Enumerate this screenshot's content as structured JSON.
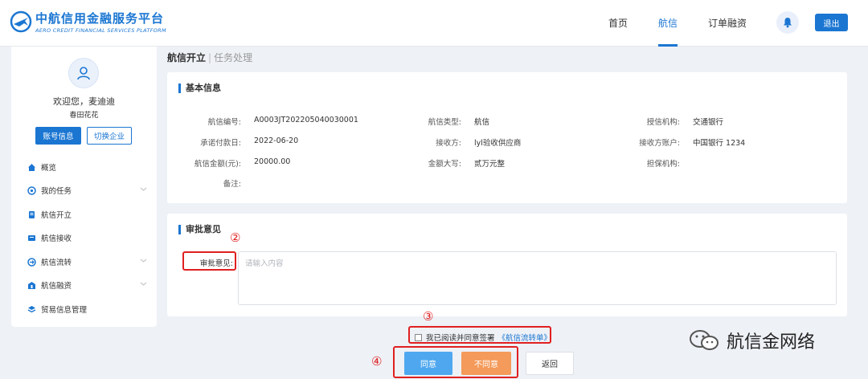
{
  "header": {
    "logo_cn": "中航信用金融服务平台",
    "logo_en": "AERO CREDIT FINANCIAL SERVICES PLATFORM",
    "nav": [
      {
        "label": "首页"
      },
      {
        "label": "航信"
      },
      {
        "label": "订单融资"
      }
    ],
    "active_nav": "航信",
    "logout_label": "退出"
  },
  "sidebar": {
    "welcome": "欢迎您，麦迪迪",
    "company": "春田花花",
    "account_btn": "账号信息",
    "switch_btn": "切换企业",
    "menu": [
      {
        "label": "概览",
        "icon": "home-icon"
      },
      {
        "label": "我的任务",
        "icon": "task-icon"
      },
      {
        "label": "航信开立",
        "icon": "document-icon"
      },
      {
        "label": "航信接收",
        "icon": "inbox-icon"
      },
      {
        "label": "航信流转",
        "icon": "transfer-icon"
      },
      {
        "label": "航信融资",
        "icon": "finance-icon"
      },
      {
        "label": "贸易信息管理",
        "icon": "stack-icon"
      }
    ]
  },
  "breadcrumb": {
    "main": "航信开立",
    "sep": "|",
    "sub": "任务处理"
  },
  "basic_info": {
    "title": "基本信息",
    "fields": {
      "code_label": "航信编号:",
      "code_value": "A0003JT202205040030001",
      "type_label": "航信类型:",
      "type_value": "航信",
      "org_label": "授信机构:",
      "org_value": "交通银行",
      "date_label": "承诺付款日:",
      "date_value": "2022-06-20",
      "receiver_label": "接收方:",
      "receiver_value": "lyl验收供应商",
      "account_label": "接收方账户:",
      "account_value": "中国银行 1234",
      "amount_label": "航信金额(元):",
      "amount_value": "20000.00",
      "capital_label": "金额大写:",
      "capital_value": "贰万元整",
      "guarantor_label": "担保机构:",
      "guarantor_value": "",
      "remark_label": "备注:",
      "remark_value": ""
    }
  },
  "approval": {
    "title": "审批意见",
    "label": "审批意见:",
    "placeholder": "请输入内容"
  },
  "agree": {
    "text": "我已阅读并同意签署",
    "link": "《航信流转单》"
  },
  "buttons": {
    "agree": "同意",
    "disagree": "不同意",
    "back": "返回"
  },
  "annotations": {
    "n2": "②",
    "n3": "③",
    "n4": "④"
  },
  "watermark": "航信金网络",
  "colors": {
    "primary": "#1b76d2",
    "agree": "#4fa8ef",
    "disagree": "#f49a5a",
    "annotation": "#e02020"
  }
}
